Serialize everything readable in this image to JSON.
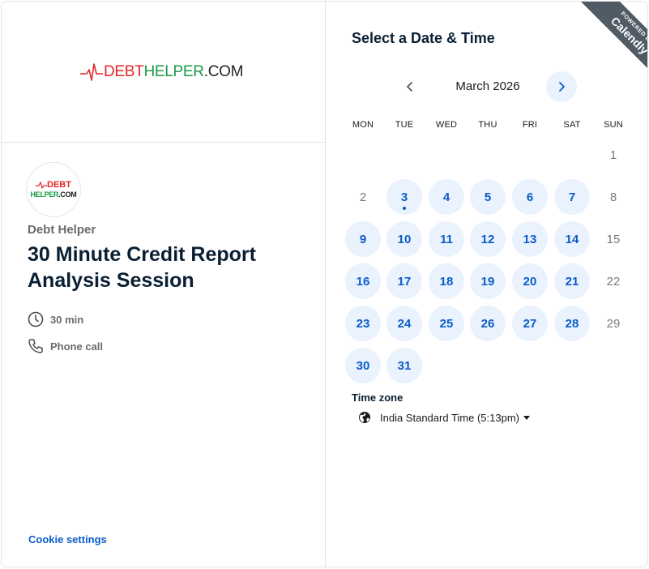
{
  "brand": {
    "logo_debt": "DEBT",
    "logo_helper": "HELPER",
    "logo_dotcom": ".COM",
    "avatar_line1": "DEBT",
    "avatar_line2a": "HELPER",
    "avatar_line2b": ".COM"
  },
  "event": {
    "organizer": "Debt Helper",
    "title": "30 Minute Credit Report Analysis Session",
    "duration": "30 min",
    "location": "Phone call"
  },
  "footer": {
    "cookie_settings": "Cookie settings"
  },
  "ribbon": {
    "powered_by": "POWERED BY",
    "brand": "Calendly"
  },
  "calendar": {
    "heading": "Select a Date & Time",
    "month_label": "March 2026",
    "weekdays": [
      "MON",
      "TUE",
      "WED",
      "THU",
      "FRI",
      "SAT",
      "SUN"
    ],
    "weeks": [
      [
        null,
        null,
        null,
        null,
        null,
        null,
        {
          "d": "1",
          "avail": false
        }
      ],
      [
        {
          "d": "2",
          "avail": false
        },
        {
          "d": "3",
          "avail": true,
          "today": true
        },
        {
          "d": "4",
          "avail": true
        },
        {
          "d": "5",
          "avail": true
        },
        {
          "d": "6",
          "avail": true
        },
        {
          "d": "7",
          "avail": true
        },
        {
          "d": "8",
          "avail": false
        }
      ],
      [
        {
          "d": "9",
          "avail": true
        },
        {
          "d": "10",
          "avail": true
        },
        {
          "d": "11",
          "avail": true
        },
        {
          "d": "12",
          "avail": true
        },
        {
          "d": "13",
          "avail": true
        },
        {
          "d": "14",
          "avail": true
        },
        {
          "d": "15",
          "avail": false
        }
      ],
      [
        {
          "d": "16",
          "avail": true
        },
        {
          "d": "17",
          "avail": true
        },
        {
          "d": "18",
          "avail": true
        },
        {
          "d": "19",
          "avail": true
        },
        {
          "d": "20",
          "avail": true
        },
        {
          "d": "21",
          "avail": true
        },
        {
          "d": "22",
          "avail": false
        }
      ],
      [
        {
          "d": "23",
          "avail": true
        },
        {
          "d": "24",
          "avail": true
        },
        {
          "d": "25",
          "avail": true
        },
        {
          "d": "26",
          "avail": true
        },
        {
          "d": "27",
          "avail": true
        },
        {
          "d": "28",
          "avail": true
        },
        {
          "d": "29",
          "avail": false
        }
      ],
      [
        {
          "d": "30",
          "avail": true
        },
        {
          "d": "31",
          "avail": true
        },
        null,
        null,
        null,
        null,
        null
      ]
    ]
  },
  "timezone": {
    "label": "Time zone",
    "value": "India Standard Time (5:13pm)"
  },
  "colors": {
    "accent": "#0b5cc8",
    "available_bg": "#e9f2fd",
    "logo_red": "#e3262b",
    "logo_green": "#1a9b47",
    "ribbon": "#505b66"
  },
  "icons": {
    "prev": "chevron-left-icon",
    "next": "chevron-right-icon",
    "duration": "clock-icon",
    "location": "phone-icon",
    "timezone": "globe-icon"
  }
}
